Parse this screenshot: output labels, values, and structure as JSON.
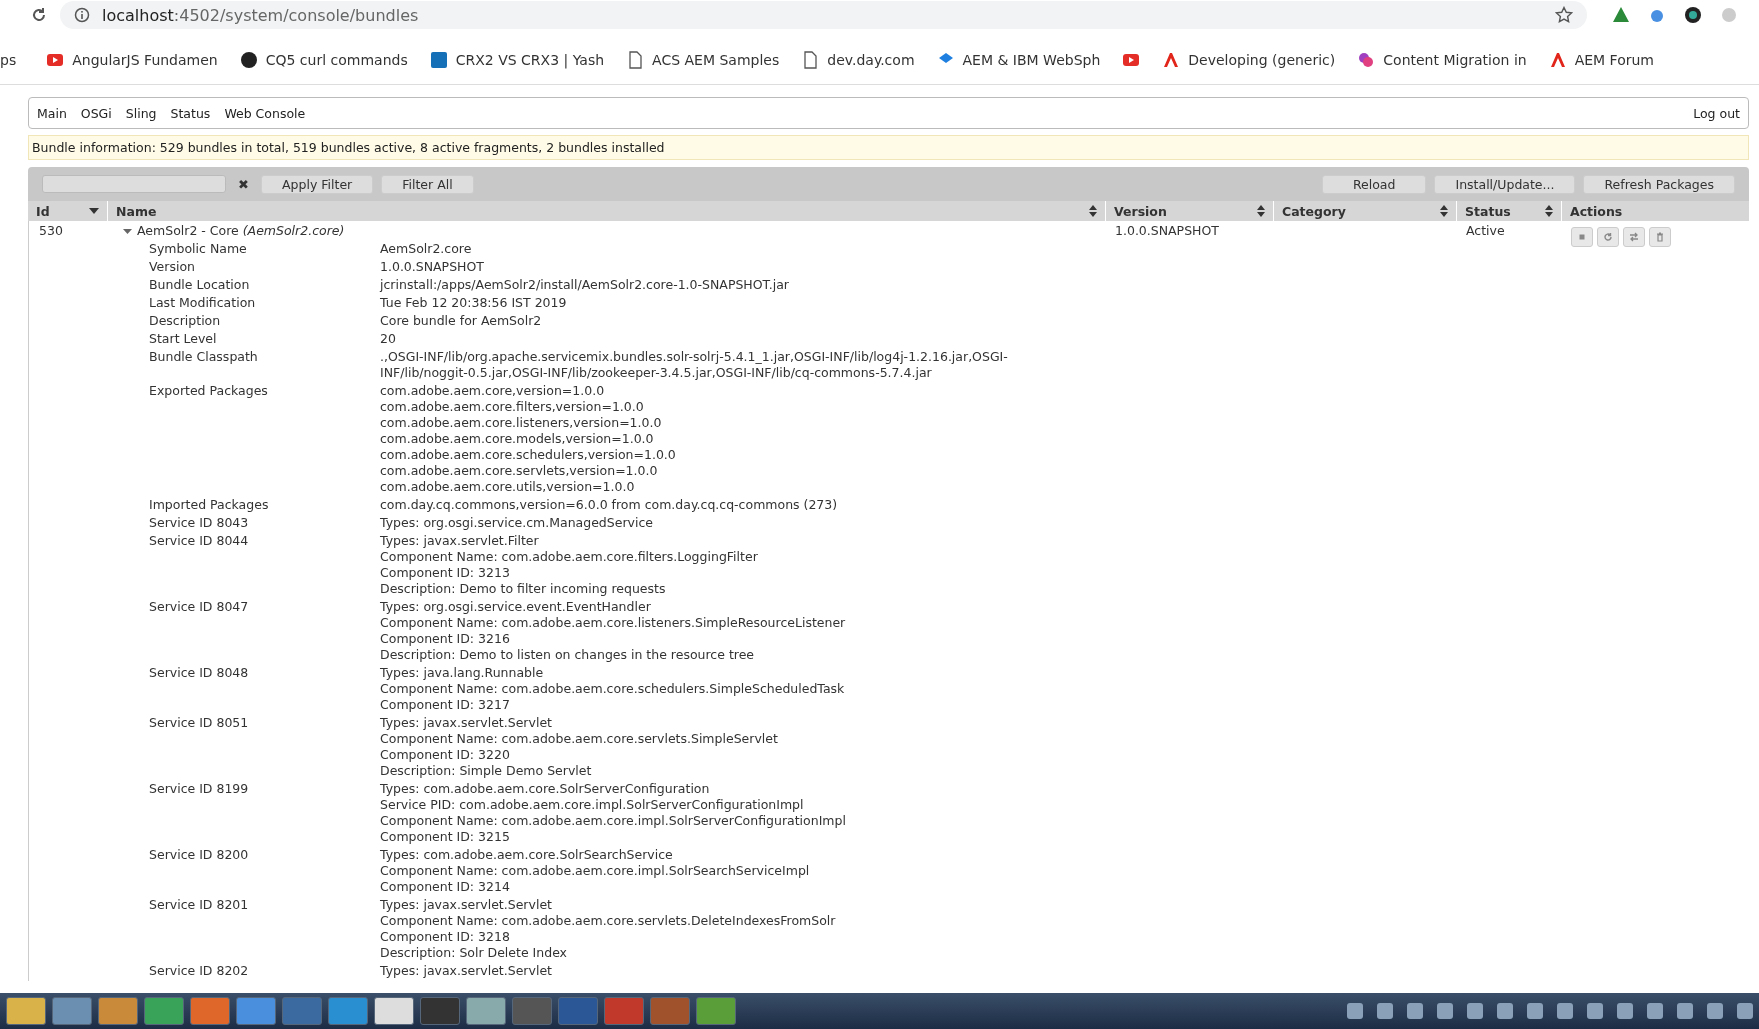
{
  "browser": {
    "url_host": "localhost",
    "url_path": ":4502/system/console/bundles",
    "bookmarks": [
      {
        "label": "ps"
      },
      {
        "label": "AngularJS Fundamen",
        "kind": "play"
      },
      {
        "label": "CQ5 curl commands",
        "kind": "circle"
      },
      {
        "label": "CRX2 VS CRX3 | Yash",
        "kind": "square"
      },
      {
        "label": "ACS AEM Samples",
        "kind": "document"
      },
      {
        "label": "dev.day.com",
        "kind": "document"
      },
      {
        "label": "AEM & IBM WebSph",
        "kind": "diamond"
      },
      {
        "kind": "play"
      },
      {
        "label": "Developing (generic)",
        "kind": "triangle"
      },
      {
        "label": "Content Migration in",
        "kind": "cluster"
      },
      {
        "label": "AEM Forum",
        "kind": "triangle"
      }
    ]
  },
  "nav": {
    "items": [
      "Main",
      "OSGi",
      "Sling",
      "Status",
      "Web Console"
    ],
    "logout": "Log out"
  },
  "info": "Bundle information: 529 bundles in total, 519 bundles active, 8 active fragments, 2 bundles installed",
  "toolbar": {
    "clear": "✖",
    "left_buttons": [
      "Apply Filter",
      "Filter All"
    ],
    "right_buttons": [
      "Reload",
      "Install/Update...",
      "Refresh Packages"
    ]
  },
  "table": {
    "columns": [
      {
        "label": "Id",
        "kind": "sorted"
      },
      {
        "label": "Name",
        "kind": "sortable"
      },
      {
        "label": "Version",
        "kind": "sortable"
      },
      {
        "label": "Category",
        "kind": "sortable"
      },
      {
        "label": "Status",
        "kind": "sortable"
      },
      {
        "label": "Actions",
        "kind": "plain"
      }
    ],
    "rows": [
      {
        "id": "530",
        "name": "AemSolr2 - Core",
        "symbolic": "(AemSolr2.core)",
        "expanded": true,
        "version": "1.0.0.SNAPSHOT",
        "status": "Active",
        "details": [
          {
            "label": "Symbolic Name",
            "lines": [
              "AemSolr2.core"
            ]
          },
          {
            "label": "Version",
            "lines": [
              "1.0.0.SNAPSHOT"
            ]
          },
          {
            "label": "Bundle Location",
            "lines": [
              "jcrinstall:/apps/AemSolr2/install/AemSolr2.core-1.0-SNAPSHOT.jar"
            ]
          },
          {
            "label": "Last Modification",
            "lines": [
              "Tue Feb 12 20:38:56 IST 2019"
            ]
          },
          {
            "label": "Description",
            "lines": [
              "Core bundle for AemSolr2"
            ]
          },
          {
            "label": "Start Level",
            "lines": [
              "20"
            ]
          },
          {
            "label": "Bundle Classpath",
            "lines": [
              ".,OSGI-INF/lib/org.apache.servicemix.bundles.solr-solrj-5.4.1_1.jar,OSGI-INF/lib/log4j-1.2.16.jar,OSGI-",
              "INF/lib/noggit-0.5.jar,OSGI-INF/lib/zookeeper-3.4.5.jar,OSGI-INF/lib/cq-commons-5.7.4.jar"
            ]
          },
          {
            "label": "Exported Packages",
            "lines": [
              "com.adobe.aem.core,version=1.0.0",
              "com.adobe.aem.core.filters,version=1.0.0",
              "com.adobe.aem.core.listeners,version=1.0.0",
              "com.adobe.aem.core.models,version=1.0.0",
              "com.adobe.aem.core.schedulers,version=1.0.0",
              "com.adobe.aem.core.servlets,version=1.0.0",
              "com.adobe.aem.core.utils,version=1.0.0"
            ]
          },
          {
            "label": "Imported Packages",
            "lines": [
              "com.day.cq.commons,version=6.0.0 from com.day.cq.cq-commons (273)"
            ]
          },
          {
            "label": "Service ID 8043",
            "lines": [
              "Types: org.osgi.service.cm.ManagedService"
            ]
          },
          {
            "label": "Service ID 8044",
            "lines": [
              "Types: javax.servlet.Filter",
              "Component Name: com.adobe.aem.core.filters.LoggingFilter",
              "Component ID: 3213",
              "Description: Demo to filter incoming requests"
            ]
          },
          {
            "label": "Service ID 8047",
            "lines": [
              "Types: org.osgi.service.event.EventHandler",
              "Component Name: com.adobe.aem.core.listeners.SimpleResourceListener",
              "Component ID: 3216",
              "Description: Demo to listen on changes in the resource tree"
            ]
          },
          {
            "label": "Service ID 8048",
            "lines": [
              "Types: java.lang.Runnable",
              "Component Name: com.adobe.aem.core.schedulers.SimpleScheduledTask",
              "Component ID: 3217"
            ]
          },
          {
            "label": "Service ID 8051",
            "lines": [
              "Types: javax.servlet.Servlet",
              "Component Name: com.adobe.aem.core.servlets.SimpleServlet",
              "Component ID: 3220",
              "Description: Simple Demo Servlet"
            ]
          },
          {
            "label": "Service ID 8199",
            "lines": [
              "Types: com.adobe.aem.core.SolrServerConfiguration",
              "Service PID: com.adobe.aem.core.impl.SolrServerConfigurationImpl",
              "Component Name: com.adobe.aem.core.impl.SolrServerConfigurationImpl",
              "Component ID: 3215"
            ]
          },
          {
            "label": "Service ID 8200",
            "lines": [
              "Types: com.adobe.aem.core.SolrSearchService",
              "Component Name: com.adobe.aem.core.impl.SolrSearchServiceImpl",
              "Component ID: 3214"
            ]
          },
          {
            "label": "Service ID 8201",
            "lines": [
              "Types: javax.servlet.Servlet",
              "Component Name: com.adobe.aem.core.servlets.DeleteIndexesFromSolr",
              "Component ID: 3218",
              "Description: Solr Delete Index"
            ]
          },
          {
            "label": "Service ID 8202",
            "lines": [
              "Types: javax.servlet.Servlet"
            ]
          }
        ]
      }
    ]
  }
}
